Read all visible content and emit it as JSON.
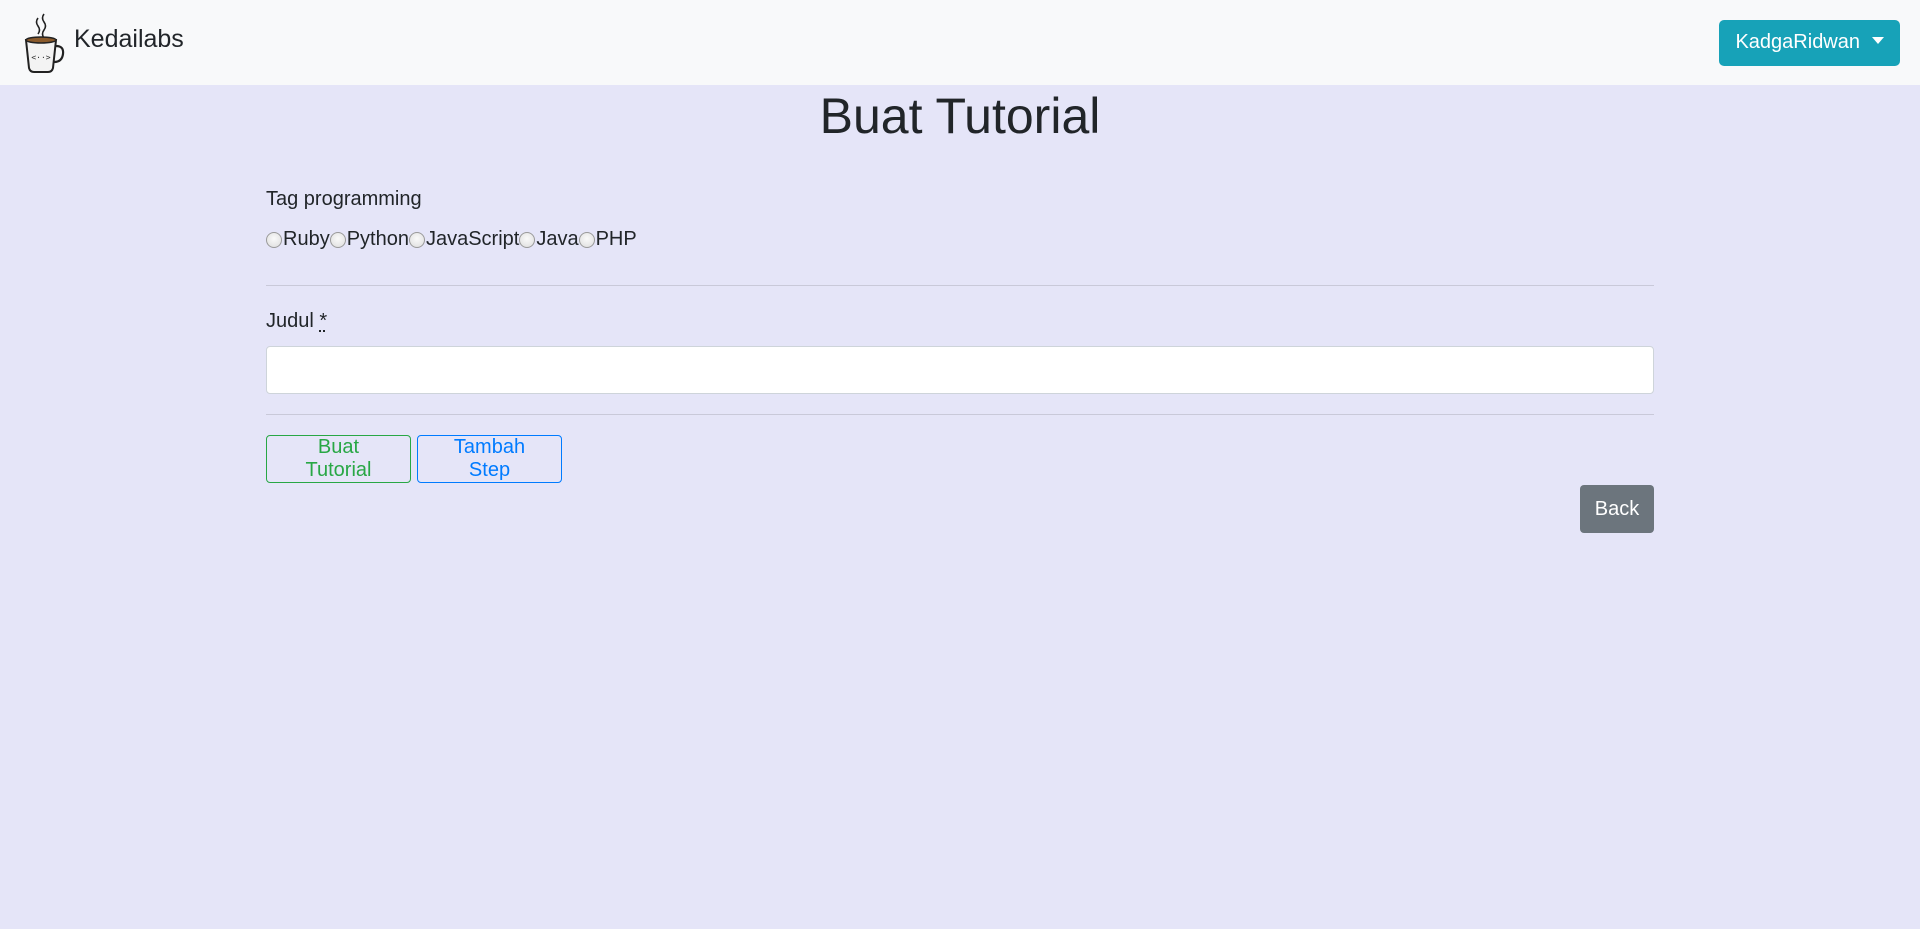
{
  "navbar": {
    "brand_name": "Kedailabs",
    "logo_icon": "coffee-cup-code-icon",
    "user_menu_label": "KadgaRidwan"
  },
  "page": {
    "title": "Buat Tutorial"
  },
  "form": {
    "tag_label": "Tag programming",
    "tags": [
      "Ruby",
      "Python",
      "JavaScript",
      "Java",
      "PHP"
    ],
    "judul_label": "Judul",
    "judul_required_mark": "*",
    "judul_value": "",
    "judul_placeholder": ""
  },
  "actions": {
    "create_label": "Buat Tutorial",
    "add_step_label": "Tambah Step",
    "back_label": "Back"
  },
  "colors": {
    "background": "#e5e5f8",
    "navbar": "#f8f9fa",
    "user_button": "#17a2b8",
    "success": "#28a745",
    "primary": "#007bff",
    "secondary": "#6c757d"
  }
}
